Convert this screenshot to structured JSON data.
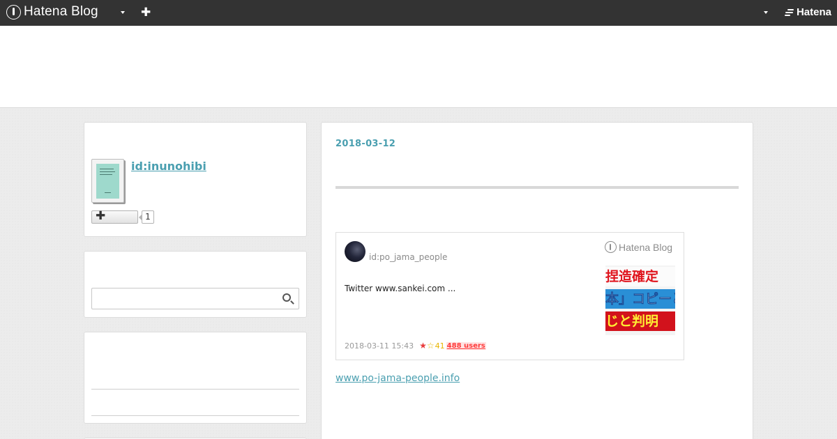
{
  "topbar": {
    "brand": "Hatena Blog",
    "hatena_label": "Hatena"
  },
  "profile": {
    "user_id": "id:inunohibi",
    "subscriber_count": "1"
  },
  "search": {
    "value": "",
    "placeholder": ""
  },
  "entry": {
    "date": "2018-03-12",
    "link_text": "www.po-jama-people.info",
    "embed": {
      "user": "id:po_jama_people",
      "brand": "Hatena Blog",
      "excerpt": "Twitter www.sankei.com ...",
      "thumbnail_text": [
        "捏造確定",
        "本」コピーと",
        "じと判明"
      ],
      "timestamp": "2018-03-11 15:43",
      "star_count": "41",
      "bookmark_users": "488 users"
    }
  },
  "colors": {
    "topbar_bg": "#333333",
    "accent": "#4a9fb0",
    "star_red": "#e83b3b",
    "star_yellow": "#e8b400",
    "users_badge": "#ff3a3a"
  }
}
